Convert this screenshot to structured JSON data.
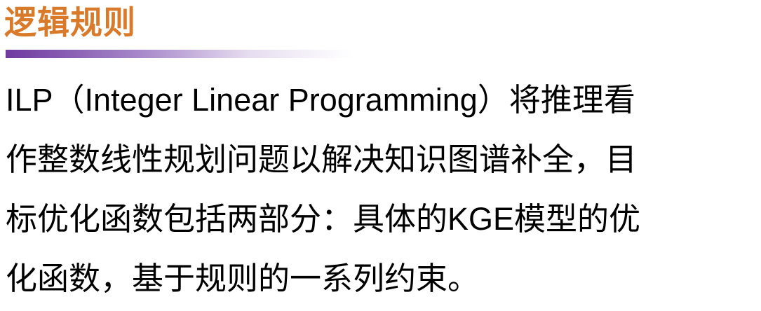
{
  "slide": {
    "title": "逻辑规则",
    "accent_colors": {
      "title": "#d97a2a",
      "bar_start": "#6f3a9f"
    },
    "body_lines": [
      "ILP（Integer Linear Programming）将推理看",
      "作整数线性规划问题以解决知识图谱补全，目",
      "标优化函数包括两部分：具体的KGE模型的优",
      "化函数，基于规则的一系列约束。"
    ]
  }
}
